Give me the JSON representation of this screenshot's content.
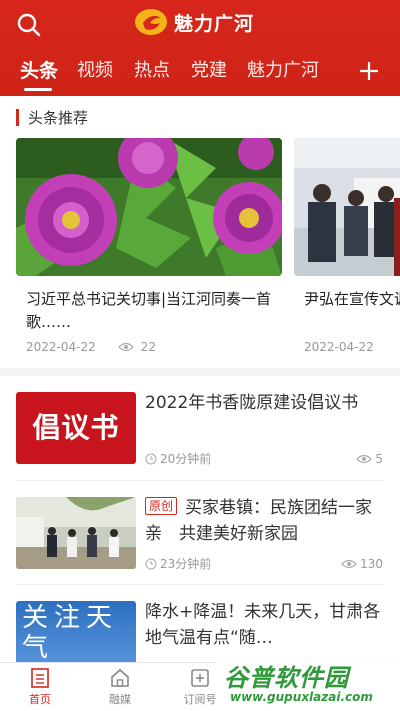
{
  "header": {
    "logo_text": "魅力广河",
    "accent_color": "#d7261b",
    "tabs": [
      {
        "label": "头条",
        "active": true
      },
      {
        "label": "视频",
        "active": false
      },
      {
        "label": "热点",
        "active": false
      },
      {
        "label": "党建",
        "active": false
      },
      {
        "label": "魅力广河",
        "active": false
      }
    ],
    "search_icon": "search-icon",
    "add_icon": "plus-icon"
  },
  "section": {
    "title": "头条推荐"
  },
  "carousel": [
    {
      "title": "习近平总书记关切事|当江河同奏一首歌……",
      "date": "2022-04-22",
      "views": "22"
    },
    {
      "title": "尹弘在宣传文调：不断壮大",
      "date": "2022-04-22",
      "views": ""
    }
  ],
  "news": [
    {
      "thumb_text": "倡议书",
      "title": "2022年书香陇原建设倡议书",
      "time": "20分钟前",
      "views": "5",
      "original": false
    },
    {
      "thumb_text": "",
      "tag": "原创",
      "title": "买家巷镇：民族团结一家亲　共建美好新家园",
      "time": "23分钟前",
      "views": "130",
      "original": true
    },
    {
      "thumb_text": "关注天气",
      "title": "降水+降温！未来几天，甘肃各地气温有点“随…",
      "time": "",
      "views": "",
      "original": false
    }
  ],
  "bottom_nav": [
    {
      "label": "首页",
      "icon": "home-news-icon",
      "active": true
    },
    {
      "label": "融媒",
      "icon": "house-icon",
      "active": false
    },
    {
      "label": "订阅号",
      "icon": "subscribe-icon",
      "active": false
    }
  ],
  "watermark": {
    "logo": "谷普软件园",
    "url": "www.gupuxlazai.com"
  }
}
